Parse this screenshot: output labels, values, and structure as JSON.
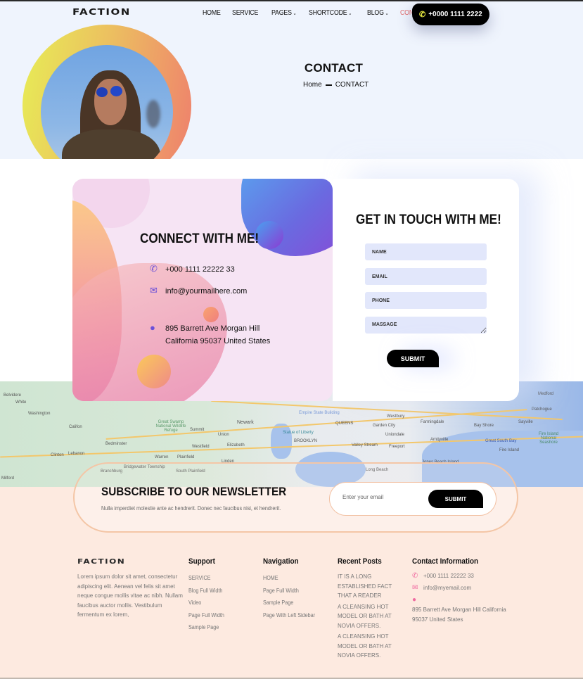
{
  "header": {
    "logo": "FACTION",
    "nav": [
      {
        "label": "HOME",
        "has_dropdown": false,
        "active": false
      },
      {
        "label": "SERVICE",
        "has_dropdown": false,
        "active": false
      },
      {
        "label": "PAGES",
        "has_dropdown": true,
        "active": false
      },
      {
        "label": "SHORTCODE",
        "has_dropdown": true,
        "active": false
      },
      {
        "label": "BLOG",
        "has_dropdown": true,
        "active": false
      },
      {
        "label": "CONTACT",
        "has_dropdown": false,
        "active": true
      }
    ],
    "phone_button": "+0000 1111 2222",
    "chevron_glyph": "⌄"
  },
  "hero": {
    "title": "CONTACT",
    "breadcrumb": {
      "home": "Home",
      "current": "CONTACT"
    }
  },
  "contact_card": {
    "title": "CONNECT WITH ME!",
    "phone": "+000 1111 22222 33",
    "email": "info@yourmailhere.com",
    "address_line1": "895 Barrett Ave Morgan Hill",
    "address_line2": "California 95037 United States"
  },
  "form": {
    "title": "GET IN TOUCH WITH ME!",
    "name_placeholder": "NAME",
    "email_placeholder": "EMAIL",
    "phone_placeholder": "PHONE",
    "message_placeholder": "MASSAGE",
    "submit_label": "SUBMIT"
  },
  "map": {
    "labels": [
      "Belvidere",
      "White",
      "Washington",
      "Califon",
      "Clinton",
      "Lebanon",
      "Bedminster",
      "Great Swamp National Wildlife Refuge",
      "Summit",
      "Newark",
      "Union",
      "Westfield",
      "Elizabeth",
      "Warren",
      "Plainfield",
      "Linden",
      "Bridgewater Township",
      "Branchburg",
      "South Plainfield",
      "Milford",
      "Empire State Building",
      "Statue of Liberty",
      "QUEENS",
      "BROOKLYN",
      "Westbury",
      "Garden City",
      "Uniondale",
      "Farmingdale",
      "Valley Stream",
      "Freeport",
      "Amityville",
      "Bay Shore",
      "Patchogue",
      "Medford",
      "Sayville",
      "Great South Bay",
      "Fire Island",
      "Fire Island National Seashore",
      "Long Beach",
      "Jones Beach Island"
    ]
  },
  "newsletter": {
    "title": "SUBSCRIBE TO OUR NEWSLETTER",
    "subtitle": "Nulla imperdiet molestie ante ac hendrerit. Donec nec faucibus nisi, et hendrerit.",
    "email_placeholder": "Enter your email",
    "submit_label": "SUBMIT"
  },
  "footer": {
    "logo": "FACTION",
    "about": "Lorem ipsum dolor sit amet, consectetur adipiscing elit. Aenean vel felis sit amet neque congue mollis vitae ac nibh. Nullam faucibus auctor mollis. Vestibulum fermentum ex lorem,",
    "support": {
      "heading": "Support",
      "links": [
        "SERVICE",
        "Blog Full Width",
        "Video",
        "Page Full Width",
        "Sample Page"
      ]
    },
    "navigation": {
      "heading": "Navigation",
      "links": [
        "HOME",
        "Page Full Width",
        "Sample Page",
        "Page With Left Sidebar"
      ]
    },
    "recent_posts": {
      "heading": "Recent Posts",
      "posts": [
        "IT IS A LONG ESTABLISHED FACT THAT A READER",
        "A CLEANSING HOT MODEL OR BATH AT NOVIA OFFERS.",
        "A CLEANSING HOT MODEL OR BATH AT NOVIA OFFERS."
      ]
    },
    "contact_info": {
      "heading": "Contact Information",
      "phone": "+000 1111 22222 33",
      "email": "info@myemail.com",
      "address": "895 Barrett Ave Morgan Hill California 95037 United States"
    }
  },
  "colors": {
    "accent_active_nav": "#e26a6a",
    "phone_icon": "#e6e841",
    "footer_icons": "#f06ba0",
    "card_icons": "#6a4fd8",
    "footer_bg": "#fdeae0",
    "hero_bg": "#eff4fd"
  },
  "icons": {
    "phone": "phone-icon",
    "email": "envelope-icon",
    "location": "map-pin-icon"
  }
}
